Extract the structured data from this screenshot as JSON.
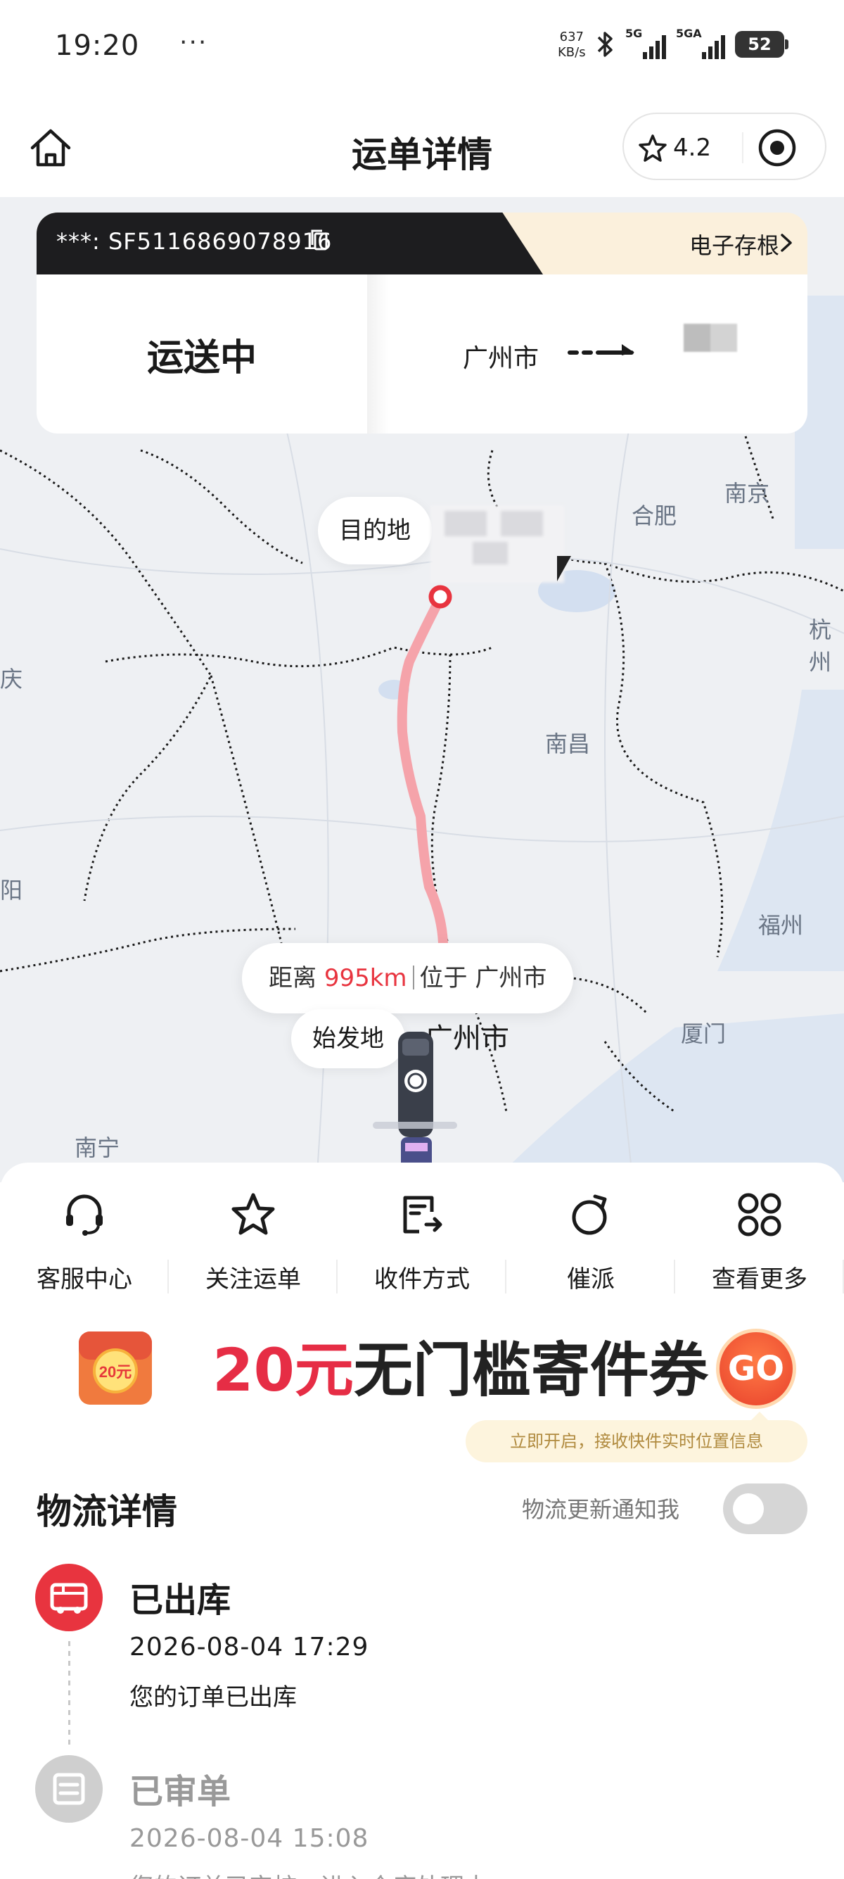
{
  "status_bar": {
    "time": "19:20",
    "more": "···",
    "net_speed_value": "637",
    "net_speed_unit": "KB/s",
    "signal1_label": "5G",
    "signal2_label": "5GA",
    "battery": "52"
  },
  "header": {
    "title": "运单详情",
    "rating": "4.2",
    "icons": [
      "home-icon",
      "star-icon",
      "target-icon"
    ]
  },
  "waybill": {
    "number": "***: SF5116869078916",
    "stub_link": "电子存根",
    "status": "运送中",
    "origin": "广州市"
  },
  "map": {
    "cities": [
      "合肥",
      "南京",
      "杭州",
      "南昌",
      "福州",
      "厦门",
      "南宁",
      "阳",
      "庆"
    ],
    "destination_label": "目的地",
    "distance_prefix": "距离",
    "distance_value": "995km",
    "location_prefix": "位于",
    "location_city": "广州市",
    "origin_label": "始发地",
    "origin_city": "广州市",
    "route_color": "#f5a3aa"
  },
  "actions": [
    {
      "label": "客服中心",
      "icon": "headset-icon"
    },
    {
      "label": "关注运单",
      "icon": "star-icon"
    },
    {
      "label": "收件方式",
      "icon": "delivery-method-icon"
    },
    {
      "label": "催派",
      "icon": "timer-icon"
    },
    {
      "label": "查看更多",
      "icon": "more-grid-icon"
    }
  ],
  "coupon": {
    "badge": "20元",
    "amount": "20元",
    "text": "无门槛寄件券",
    "go": "GO"
  },
  "logistics": {
    "tip": "立即开启，接收快件实时位置信息",
    "title": "物流详情",
    "notify_label": "物流更新通知我",
    "notify_enabled": false,
    "events": [
      {
        "status": "已出库",
        "time": "2026-08-04 17:29",
        "desc": "您的订单已出库",
        "icon": "truck-icon"
      },
      {
        "status": "已审单",
        "time": "2026-08-04 15:08",
        "desc": "您的订单已审核，进入仓库处理中",
        "icon": "document-icon"
      }
    ]
  },
  "colors": {
    "accent_red": "#e8343f",
    "dark_bar": "#1d1d1f",
    "stub_bg": "#fbf0dc",
    "map_bg": "#eef0f3"
  }
}
